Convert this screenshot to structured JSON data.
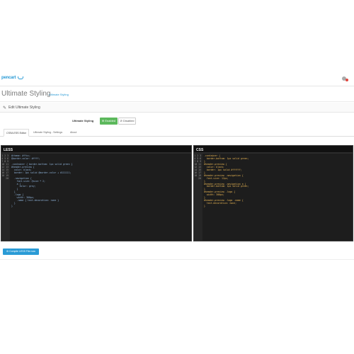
{
  "header": {
    "logo_text": "pencart"
  },
  "page": {
    "title": "Ultimate Styling",
    "breadcrumb": "Ultimate Styling"
  },
  "panel": {
    "title": "Edit Ultimate Styling"
  },
  "status": {
    "label": "Ultimate Styling",
    "enabled_label": "⊕ Enabled",
    "disabled_label": "⊘ Disabled"
  },
  "tabs": [
    {
      "label": "CSS/LESS Editor"
    },
    {
      "label": "Ultimate Styling - Settings"
    },
    {
      "label": "About"
    }
  ],
  "less_editor": {
    "title": "LESS",
    "line_numbers": "1\n2\n3\n4\n5\n6\n7\n8\n9\n10\n11\n12\n13\n14\n15\n16\n17\n18\n19\n20",
    "code": "@theme: #ffcc;\n@border-color: #ffff;\n\n.container { border-bottom: 1px solid green }\n#header-preview {\n  color: black;\n  border: 1px solid @border-color + #111111;\n\n  .navigation {\n    font-size: @size * 2;\n    a {\n      color: grey;\n    }\n  }\n  .logo {\n    width: 300px;\n    .name { text-decoration: none }\n  }\n}\n"
  },
  "css_editor": {
    "title": "CSS",
    "line_numbers": "1\n2\n3\n4\n5\n6\n7\n8\n9\n10\n11\n12\n13\n14\n15\n16\n17\n18\n19\n20",
    "code": ".container {\n  border-bottom: 1px solid green;\n}\n#header-preview {\n  color: black;\n  border: 1px solid #ffffff;\n}\n#header-preview .navigation {\n  font-size: 12px;\n}\n#header-preview .navigation a {\n  border-bottom: 1px solid green;\n}\n#header-preview .logo {\n  width: 300px;\n}\n#header-preview .logo .name {\n  text-decoration: none;\n}\n"
  },
  "footer": {
    "compile_label": "⚙ Compile LESS File now"
  }
}
